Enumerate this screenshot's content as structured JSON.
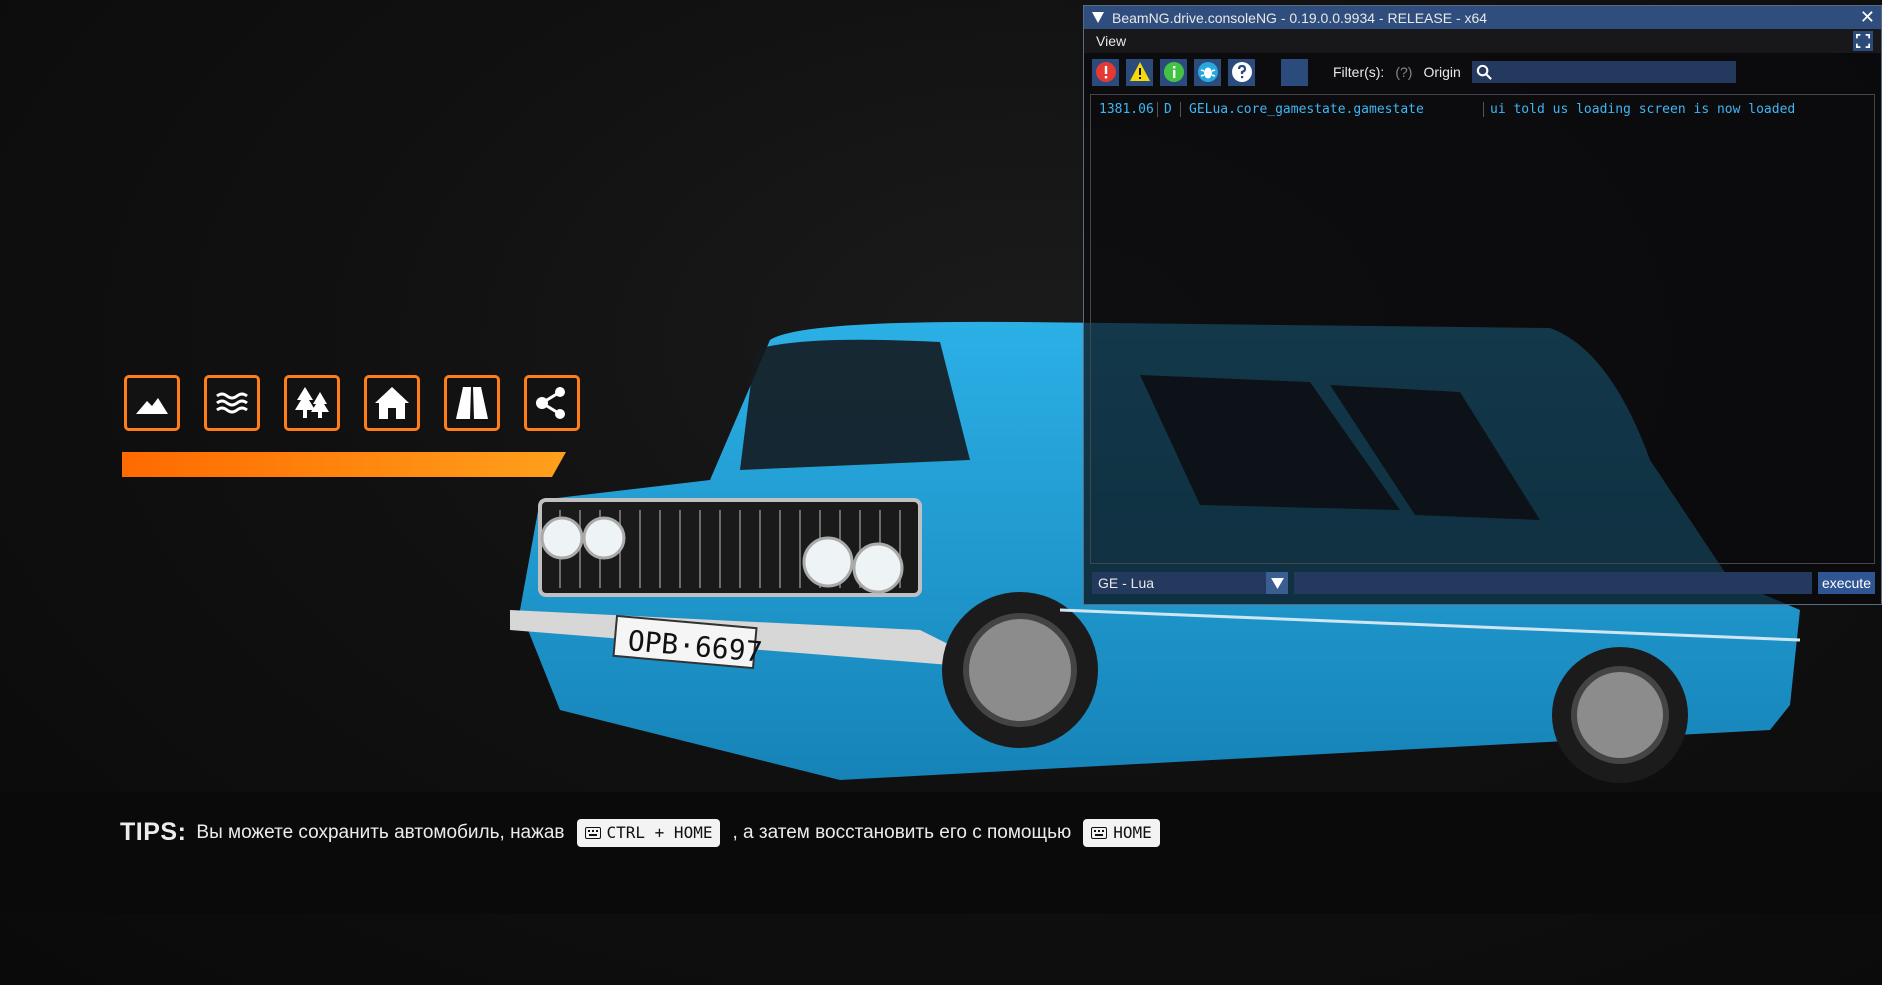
{
  "loading_screen": {
    "icons": [
      "mountain-icon",
      "water-icon",
      "forest-icon",
      "house-icon",
      "road-icon",
      "share-icon"
    ],
    "accent_color": "#ff7f16",
    "car_color": "#1e9fd6",
    "license_plate": "OPB·6697"
  },
  "tips": {
    "title": "TIPS:",
    "text_before": "Вы можете сохранить автомобиль, нажав",
    "key1": "CTRL + HOME",
    "text_middle": ", а затем восстановить его с помощью",
    "key2": "HOME"
  },
  "console": {
    "title": "BeamNG.drive.consoleNG - 0.19.0.0.9934 - RELEASE - x64",
    "close_label": "✕",
    "menu_view": "View",
    "filters_label": "Filter(s):",
    "filters_help": "(?)",
    "origin_label": "Origin",
    "search_value": "",
    "log": [
      {
        "time": "1381.06",
        "level": "D",
        "origin": "GELua.core_gamestate.gamestate",
        "message": "ui told us loading screen is now loaded"
      }
    ],
    "language": "GE - Lua",
    "command_value": "",
    "execute_label": "execute",
    "title_bar_color": "#2f4e7e",
    "log_text_color": "#3fb6f2"
  }
}
